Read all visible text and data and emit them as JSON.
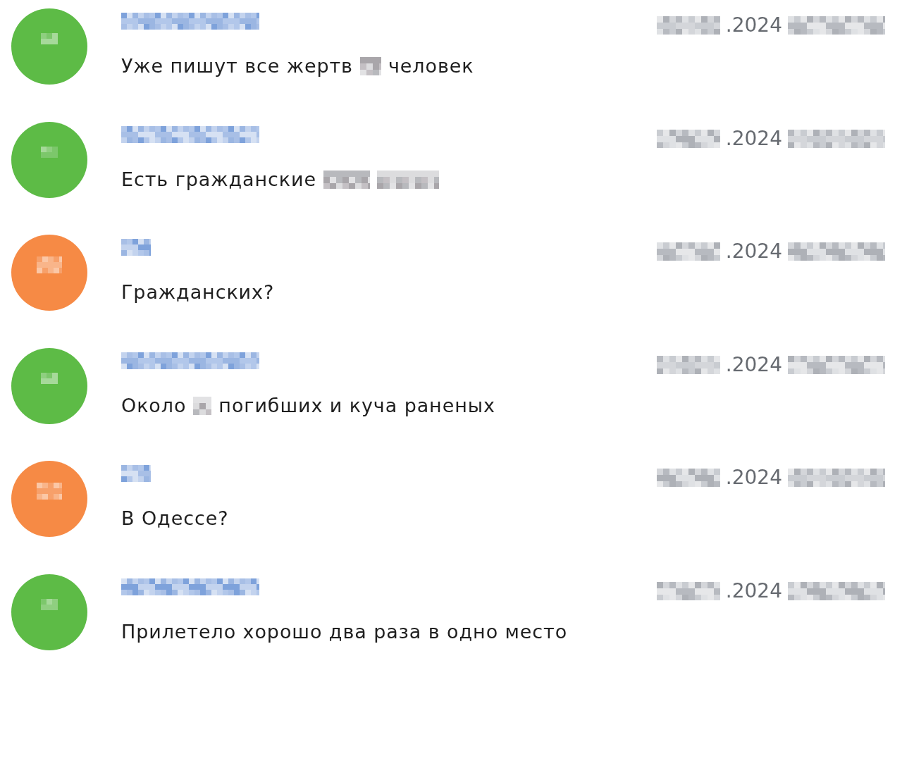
{
  "messages": [
    {
      "color": "#5dbb46",
      "time": [
        {
          "kind": "redacted"
        },
        {
          "kind": "text",
          "text": ".2024"
        },
        {
          "kind": "redacted"
        }
      ],
      "body": [
        {
          "kind": "text",
          "text": "Уже пишут все жертв"
        },
        {
          "kind": "redacted"
        },
        {
          "kind": "text",
          "text": "человек"
        }
      ]
    },
    {
      "color": "#5dbb46",
      "time": [
        {
          "kind": "redacted"
        },
        {
          "kind": "text",
          "text": ".2024"
        },
        {
          "kind": "redacted"
        }
      ],
      "body": [
        {
          "kind": "text",
          "text": "Есть гражданские"
        },
        {
          "kind": "redacted"
        },
        {
          "kind": "redacted"
        }
      ]
    },
    {
      "color": "#f68a45",
      "time": [
        {
          "kind": "redacted"
        },
        {
          "kind": "text",
          "text": ".2024"
        },
        {
          "kind": "redacted"
        }
      ],
      "body": [
        {
          "kind": "text",
          "text": "Гражданских?"
        }
      ]
    },
    {
      "color": "#5dbb46",
      "time": [
        {
          "kind": "redacted"
        },
        {
          "kind": "text",
          "text": ".2024"
        },
        {
          "kind": "redacted"
        }
      ],
      "body": [
        {
          "kind": "text",
          "text": "Около"
        },
        {
          "kind": "redacted"
        },
        {
          "kind": "text",
          "text": "погибших и куча раненых"
        }
      ]
    },
    {
      "color": "#f68a45",
      "time": [
        {
          "kind": "redacted"
        },
        {
          "kind": "text",
          "text": ".2024"
        },
        {
          "kind": "redacted"
        }
      ],
      "body": [
        {
          "kind": "text",
          "text": "В Одессе?"
        }
      ]
    },
    {
      "color": "#5dbb46",
      "time": [
        {
          "kind": "redacted"
        },
        {
          "kind": "text",
          "text": ".2024"
        },
        {
          "kind": "redacted"
        }
      ],
      "body": [
        {
          "kind": "text",
          "text": "Прилетело хорошо два раза в одно место"
        }
      ]
    }
  ]
}
